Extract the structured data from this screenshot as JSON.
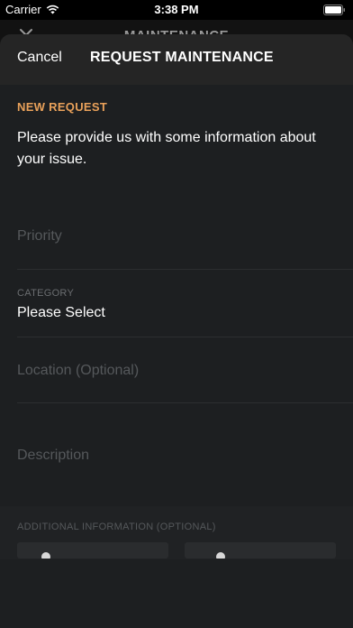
{
  "status_bar": {
    "carrier": "Carrier",
    "time": "3:38 PM"
  },
  "background_page": {
    "title": "MAINTENANCE"
  },
  "nav": {
    "cancel_label": "Cancel",
    "title": "REQUEST MAINTENANCE"
  },
  "form": {
    "section_label": "NEW REQUEST",
    "intro": "Please provide us with some information about your issue.",
    "priority_placeholder": "Priority",
    "category_label": "CATEGORY",
    "category_value": "Please Select",
    "location_placeholder": "Location (Optional)",
    "description_placeholder": "Description"
  },
  "additional": {
    "label": "ADDITIONAL INFORMATION (OPTIONAL)"
  },
  "colors": {
    "accent": "#e9a15a",
    "sheet_background": "#1d1f21",
    "nav_background": "#252525"
  }
}
